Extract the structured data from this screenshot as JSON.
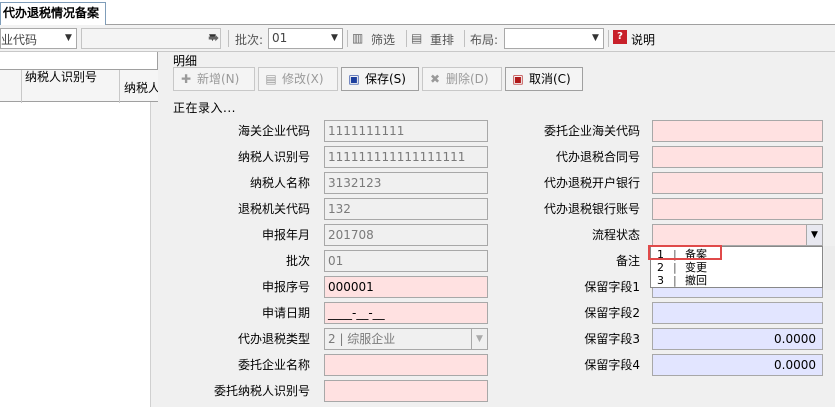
{
  "tab": {
    "title": "代办退税情况备案"
  },
  "toolbar": {
    "company_code_combo": "业代码",
    "blank_combo": "",
    "batch_label": "批次:",
    "batch_value": "01",
    "filter_label": "筛选",
    "reorder_label": "重排",
    "layout_label": "布局:",
    "layout_value": "",
    "help_label": "说明"
  },
  "grid": {
    "columns": [
      "纳税人识别号",
      "纳税人"
    ]
  },
  "detail": {
    "group_title": "明细",
    "buttons": {
      "add": "新增(N)",
      "edit": "修改(X)",
      "save": "保存(S)",
      "delete": "删除(D)",
      "cancel": "取消(C)"
    },
    "status": "正在录入...",
    "left_fields": [
      {
        "label": "海关企业代码",
        "value": "1111111111"
      },
      {
        "label": "纳税人识别号",
        "value": "111111111111111111"
      },
      {
        "label": "纳税人名称",
        "value": "3132123"
      },
      {
        "label": "退税机关代码",
        "value": "132"
      },
      {
        "label": "申报年月",
        "value": "201708"
      },
      {
        "label": "批次",
        "value": "01"
      },
      {
        "label": "申报序号",
        "value": "000001"
      },
      {
        "label": "申请日期",
        "value": "____-__-__"
      },
      {
        "label": "代办退税类型",
        "value": "2 | 综服企业"
      },
      {
        "label": "委托企业名称",
        "value": ""
      },
      {
        "label": "委托纳税人识别号",
        "value": ""
      }
    ],
    "right_fields": [
      {
        "label": "委托企业海关代码",
        "value": ""
      },
      {
        "label": "代办退税合同号",
        "value": ""
      },
      {
        "label": "代办退税开户银行",
        "value": ""
      },
      {
        "label": "代办退税银行账号",
        "value": ""
      },
      {
        "label": "流程状态",
        "value": ""
      },
      {
        "label": "备注",
        "value": ""
      },
      {
        "label": "保留字段1",
        "value": ""
      },
      {
        "label": "保留字段2",
        "value": ""
      },
      {
        "label": "保留字段3",
        "value": "0.0000"
      },
      {
        "label": "保留字段4",
        "value": "0.0000"
      }
    ],
    "dropdown_options": [
      {
        "code": "1",
        "sep": "|",
        "name": "备案"
      },
      {
        "code": "2",
        "sep": "|",
        "name": "变更"
      },
      {
        "code": "3",
        "sep": "|",
        "name": "撤回"
      }
    ]
  },
  "colors": {
    "required_field": "#ffe1e1",
    "optional_field": "#e2e5ff",
    "readonly_field": "#f0f0f0",
    "highlight": "#e04a4a"
  }
}
